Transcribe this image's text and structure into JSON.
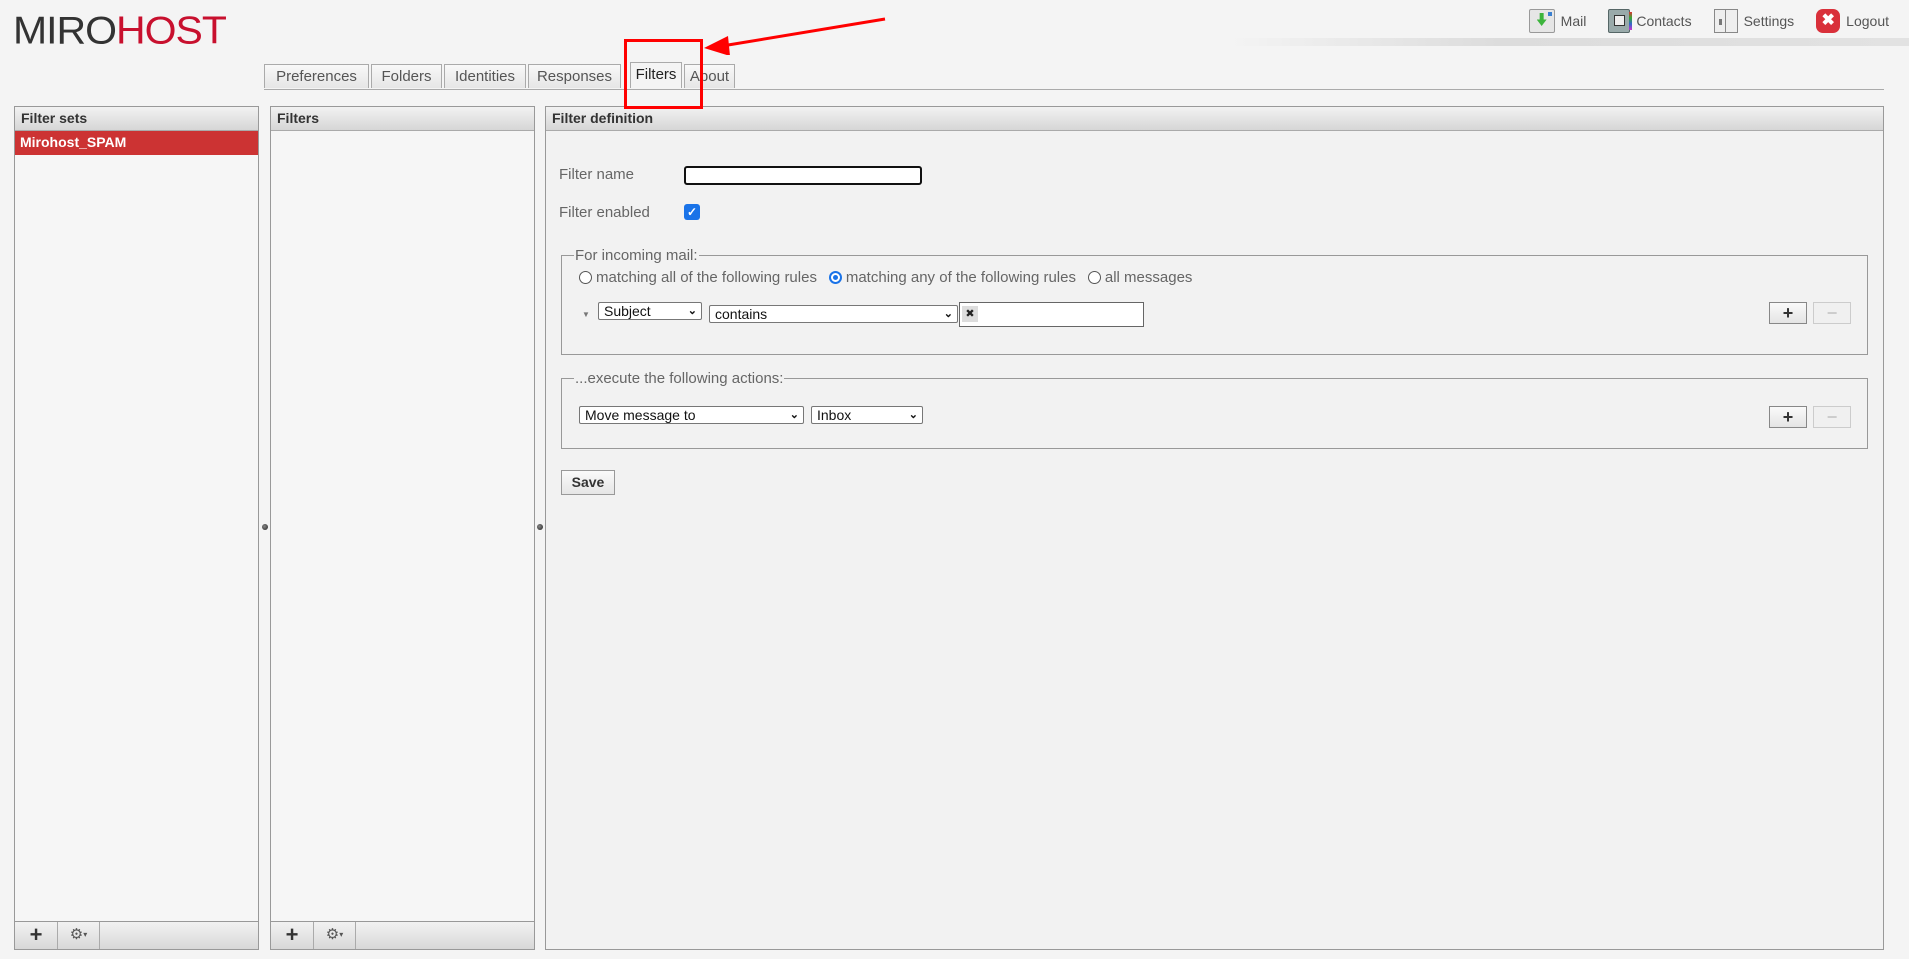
{
  "brand": {
    "part1": "MIRO",
    "part2": "HOST",
    "accent": "#c8102e"
  },
  "topnav": [
    {
      "label": "Mail",
      "icon": "mail-icon"
    },
    {
      "label": "Contacts",
      "icon": "contacts-icon"
    },
    {
      "label": "Settings",
      "icon": "settings-icon"
    },
    {
      "label": "Logout",
      "icon": "logout-icon",
      "glyph": "✖"
    }
  ],
  "tabs": [
    {
      "label": "Preferences",
      "selected": false
    },
    {
      "label": "Folders",
      "selected": false
    },
    {
      "label": "Identities",
      "selected": false
    },
    {
      "label": "Responses",
      "selected": false
    },
    {
      "label": "Filters",
      "selected": true
    },
    {
      "label": "About",
      "selected": false
    }
  ],
  "filter_sets": {
    "title": "Filter sets",
    "items": [
      {
        "label": "Mirohost_SPAM",
        "selected": true
      }
    ],
    "add_glyph": "+",
    "menu_glyph": "⚙",
    "menu_caret": "▾"
  },
  "filters": {
    "title": "Filters",
    "items": [],
    "add_glyph": "+",
    "menu_glyph": "⚙",
    "menu_caret": "▾"
  },
  "definition": {
    "title": "Filter definition",
    "name_label": "Filter name",
    "name_value": "",
    "enabled_label": "Filter enabled",
    "enabled": true,
    "check_glyph": "✓",
    "incoming_legend": "For incoming mail:",
    "match_options": [
      {
        "label": "matching all of the following rules",
        "selected": false
      },
      {
        "label": "matching any of the following rules",
        "selected": true
      },
      {
        "label": "all messages",
        "selected": false
      }
    ],
    "rule": {
      "header": "Subject",
      "operator": "contains",
      "value": ""
    },
    "actions_legend": "...execute the following actions:",
    "action": {
      "type": "Move message to",
      "folder": "Inbox"
    },
    "add_glyph": "+",
    "remove_glyph": "−",
    "chevron_glyph": "⌄",
    "save_label": "Save"
  },
  "annotation": {
    "color": "#ff0000",
    "target": "Filters tab"
  }
}
